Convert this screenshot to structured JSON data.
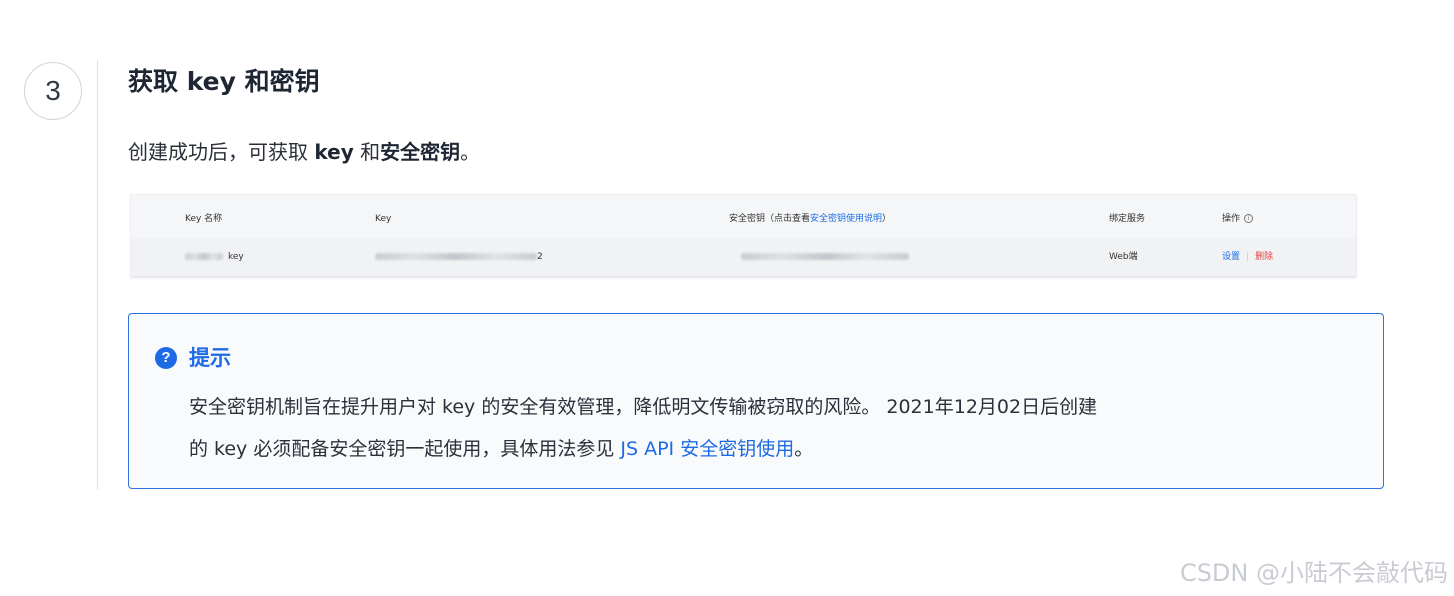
{
  "step": {
    "number": "3",
    "title": "获取 key 和密钥",
    "desc_prefix": "创建成功后，可获取 ",
    "desc_key": "key",
    "desc_mid": " 和",
    "desc_secret": "安全密钥",
    "desc_suffix": "。"
  },
  "keys_table": {
    "headers": {
      "name": "Key 名称",
      "key": "Key",
      "secret_prefix": "安全密钥（点击查看",
      "secret_link": "安全密钥使用说明",
      "secret_suffix": "）",
      "service": "绑定服务",
      "actions": "操作"
    },
    "row": {
      "name_suffix": "key",
      "key_suffix": "2",
      "service": "Web端",
      "settings_label": "设置",
      "delete_label": "删除"
    },
    "colors": {
      "link": "#1d6ce8",
      "danger": "#e54545"
    }
  },
  "tip": {
    "icon": "question-circle-icon",
    "title": "提示",
    "line1": "安全密钥机制旨在提升用户对 key 的安全有效管理，降低明文传输被窃取的风险。 2021年12月02日后创建",
    "line2_prefix": "的 key 必须配备安全密钥一起使用，具体用法参见 ",
    "line2_link": "JS API 安全密钥使用",
    "line2_suffix": "。",
    "accent_color": "#1e6ae6"
  },
  "watermark": "CSDN @小陆不会敲代码"
}
